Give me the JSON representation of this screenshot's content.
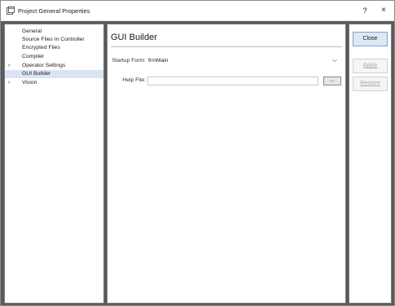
{
  "window": {
    "title": "Project General Properties",
    "help_label": "?",
    "close_label": "×"
  },
  "nav": {
    "items": [
      {
        "label": "General",
        "expandable": false,
        "selected": false
      },
      {
        "label": "Source Files In Controller",
        "expandable": false,
        "selected": false
      },
      {
        "label": "Encrypted Files",
        "expandable": false,
        "selected": false
      },
      {
        "label": "Compiler",
        "expandable": false,
        "selected": false
      },
      {
        "label": "Operator Settings",
        "expandable": true,
        "selected": false
      },
      {
        "label": "GUI Builder",
        "expandable": false,
        "selected": true
      },
      {
        "label": "Vision",
        "expandable": true,
        "selected": false
      }
    ],
    "expand_glyph": "›"
  },
  "panel": {
    "title": "GUI Builder",
    "startup_form": {
      "label": "Startup Form:",
      "value": "frmMain"
    },
    "help_file": {
      "label": "Help File:",
      "value": "",
      "browse_label": "..."
    }
  },
  "actions": {
    "close": "Close",
    "apply": "Apply",
    "restore": "Restore"
  },
  "colors": {
    "selection": "#dbe4f4",
    "accent_border": "#7d9fd0",
    "frame_bg": "#5a5a5a"
  }
}
